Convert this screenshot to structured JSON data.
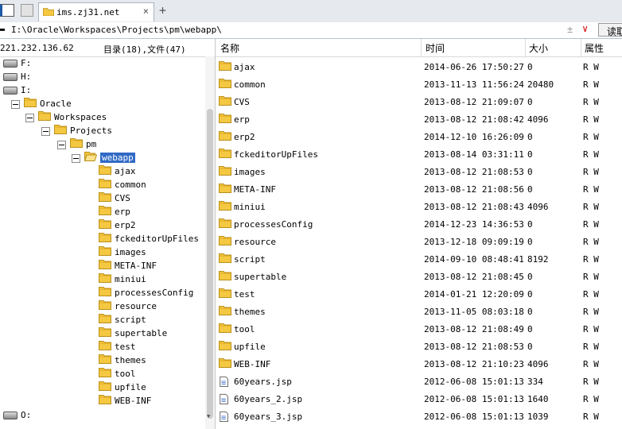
{
  "tab": {
    "label": "ims.zj31.net"
  },
  "path": {
    "value": "I:\\Oracle\\Workspaces\\Projects\\pm\\webapp\\",
    "read_button": "读取"
  },
  "left_header": {
    "ip": "221.232.136.62",
    "count": "目录(18),文件(47)"
  },
  "columns": {
    "name": "名称",
    "time": "时间",
    "size": "大小",
    "attr": "属性"
  },
  "tree": [
    {
      "label": "F:",
      "type": "drive"
    },
    {
      "label": "H:",
      "type": "drive"
    },
    {
      "label": "I:",
      "type": "drive"
    },
    {
      "label": "Oracle",
      "type": "folder"
    },
    {
      "label": "Workspaces",
      "type": "folder"
    },
    {
      "label": "Projects",
      "type": "folder"
    },
    {
      "label": "pm",
      "type": "folder"
    },
    {
      "label": "webapp",
      "type": "folder-open"
    },
    {
      "label": "ajax",
      "type": "folder"
    },
    {
      "label": "common",
      "type": "folder"
    },
    {
      "label": "CVS",
      "type": "folder"
    },
    {
      "label": "erp",
      "type": "folder"
    },
    {
      "label": "erp2",
      "type": "folder"
    },
    {
      "label": "fckeditorUpFiles",
      "type": "folder"
    },
    {
      "label": "images",
      "type": "folder"
    },
    {
      "label": "META-INF",
      "type": "folder"
    },
    {
      "label": "miniui",
      "type": "folder"
    },
    {
      "label": "processesConfig",
      "type": "folder"
    },
    {
      "label": "resource",
      "type": "folder"
    },
    {
      "label": "script",
      "type": "folder"
    },
    {
      "label": "supertable",
      "type": "folder"
    },
    {
      "label": "test",
      "type": "folder"
    },
    {
      "label": "themes",
      "type": "folder"
    },
    {
      "label": "tool",
      "type": "folder"
    },
    {
      "label": "upfile",
      "type": "folder"
    },
    {
      "label": "WEB-INF",
      "type": "folder"
    },
    {
      "label": "O:",
      "type": "drive"
    }
  ],
  "files": [
    {
      "name": "ajax",
      "time": "2014-06-26 17:50:27",
      "size": "0",
      "attr": "R W",
      "type": "folder"
    },
    {
      "name": "common",
      "time": "2013-11-13 11:56:24",
      "size": "20480",
      "attr": "R W",
      "type": "folder"
    },
    {
      "name": "CVS",
      "time": "2013-08-12 21:09:07",
      "size": "0",
      "attr": "R W",
      "type": "folder"
    },
    {
      "name": "erp",
      "time": "2013-08-12 21:08:42",
      "size": "4096",
      "attr": "R W",
      "type": "folder"
    },
    {
      "name": "erp2",
      "time": "2014-12-10 16:26:09",
      "size": "0",
      "attr": "R W",
      "type": "folder"
    },
    {
      "name": "fckeditorUpFiles",
      "time": "2013-08-14 03:31:11",
      "size": "0",
      "attr": "R W",
      "type": "folder"
    },
    {
      "name": "images",
      "time": "2013-08-12 21:08:53",
      "size": "0",
      "attr": "R W",
      "type": "folder"
    },
    {
      "name": "META-INF",
      "time": "2013-08-12 21:08:56",
      "size": "0",
      "attr": "R W",
      "type": "folder"
    },
    {
      "name": "miniui",
      "time": "2013-08-12 21:08:43",
      "size": "4096",
      "attr": "R W",
      "type": "folder"
    },
    {
      "name": "processesConfig",
      "time": "2014-12-23 14:36:53",
      "size": "0",
      "attr": "R W",
      "type": "folder"
    },
    {
      "name": "resource",
      "time": "2013-12-18 09:09:19",
      "size": "0",
      "attr": "R W",
      "type": "folder"
    },
    {
      "name": "script",
      "time": "2014-09-10 08:48:41",
      "size": "8192",
      "attr": "R W",
      "type": "folder"
    },
    {
      "name": "supertable",
      "time": "2013-08-12 21:08:45",
      "size": "0",
      "attr": "R W",
      "type": "folder"
    },
    {
      "name": "test",
      "time": "2014-01-21 12:20:09",
      "size": "0",
      "attr": "R W",
      "type": "folder"
    },
    {
      "name": "themes",
      "time": "2013-11-05 08:03:18",
      "size": "0",
      "attr": "R W",
      "type": "folder"
    },
    {
      "name": "tool",
      "time": "2013-08-12 21:08:49",
      "size": "0",
      "attr": "R W",
      "type": "folder"
    },
    {
      "name": "upfile",
      "time": "2013-08-12 21:08:53",
      "size": "0",
      "attr": "R W",
      "type": "folder"
    },
    {
      "name": "WEB-INF",
      "time": "2013-08-12 21:10:23",
      "size": "4096",
      "attr": "R W",
      "type": "folder"
    },
    {
      "name": "60years.jsp",
      "time": "2012-06-08 15:01:13",
      "size": "334",
      "attr": "R W",
      "type": "file"
    },
    {
      "name": "60years_2.jsp",
      "time": "2012-06-08 15:01:13",
      "size": "1640",
      "attr": "R W",
      "type": "file"
    },
    {
      "name": "60years_3.jsp",
      "time": "2012-06-08 15:01:13",
      "size": "1039",
      "attr": "R W",
      "type": "file"
    }
  ]
}
